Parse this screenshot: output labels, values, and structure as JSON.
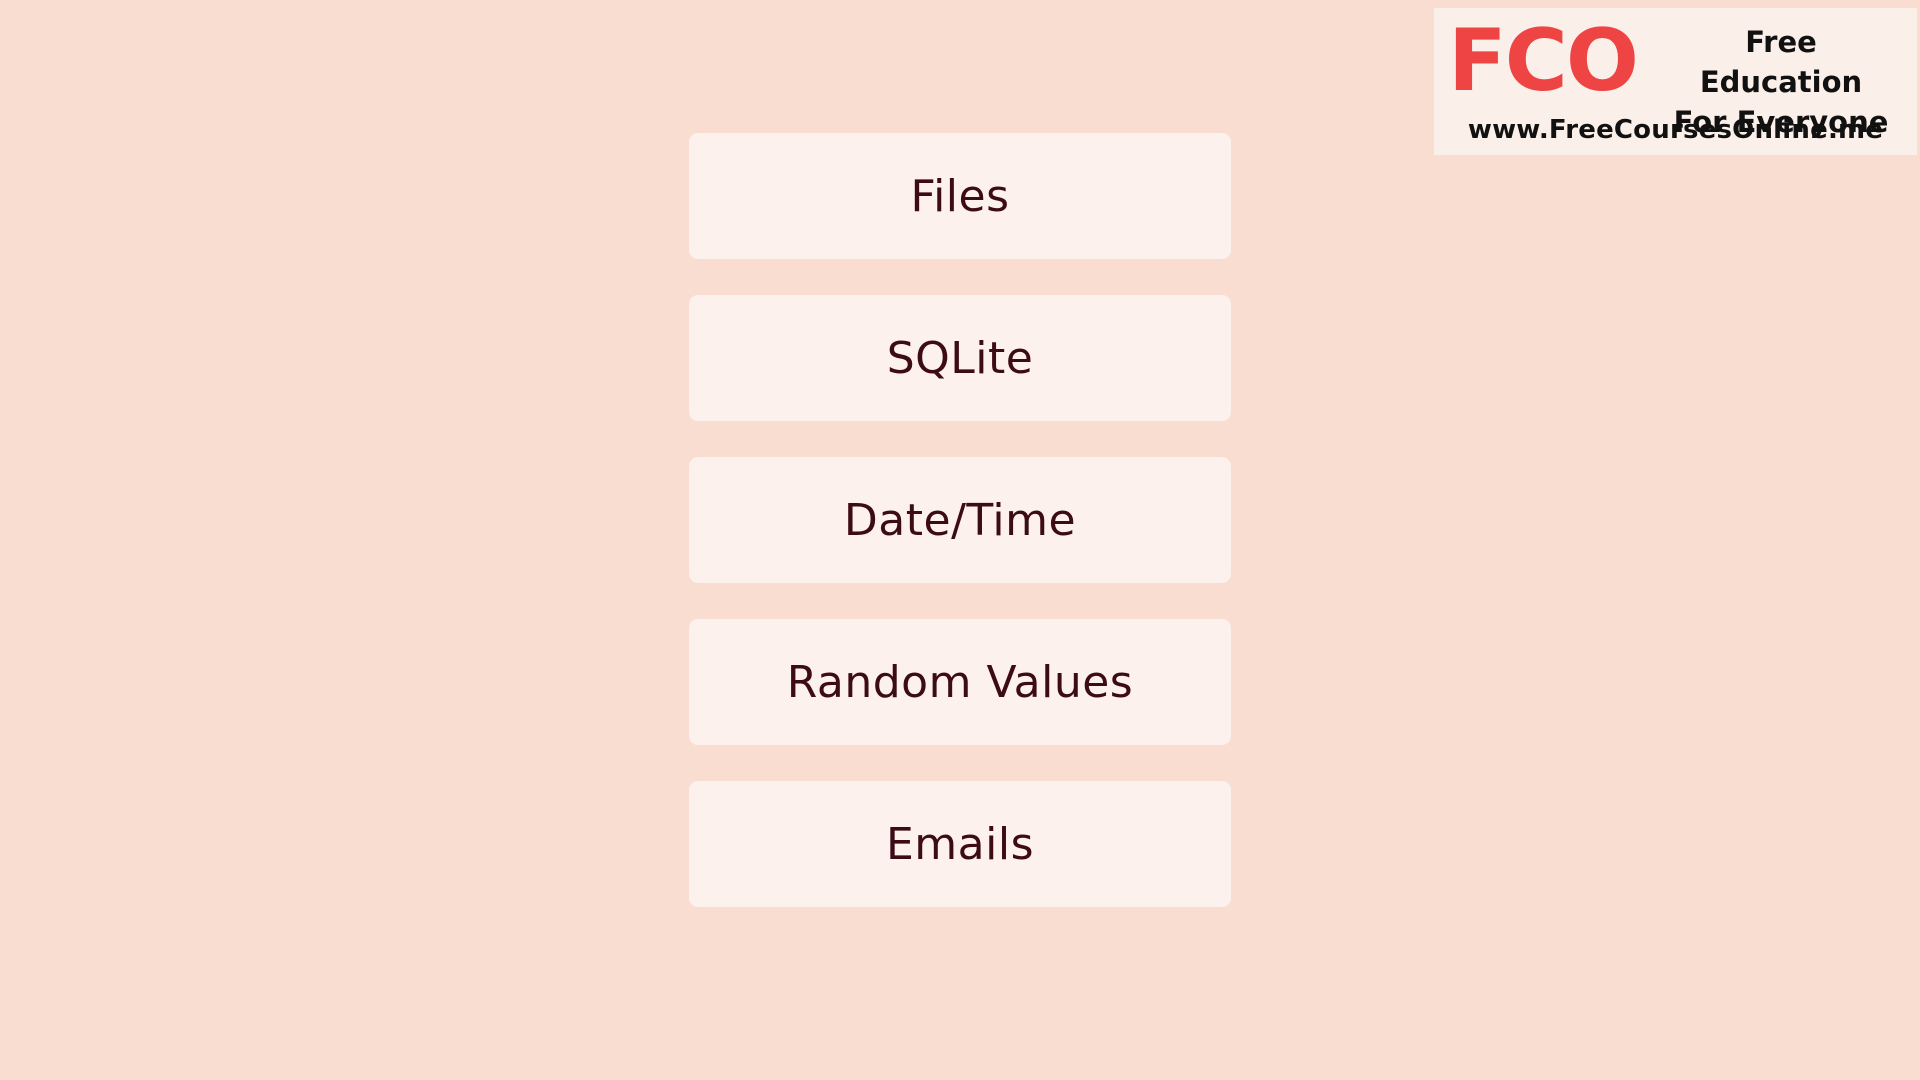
{
  "topics": [
    "Files",
    "SQLite",
    "Date/Time",
    "Random Values",
    "Emails"
  ],
  "watermark": {
    "mark": "FCO",
    "tagline_line1": "Free Education",
    "tagline_line2": "For Everyone",
    "url": "www.FreeCoursesOnline.me"
  },
  "colors": {
    "background": "#f8ddd0",
    "card": "#fcf1ec",
    "text": "#3c0b14",
    "brand_red": "#ef4444"
  }
}
